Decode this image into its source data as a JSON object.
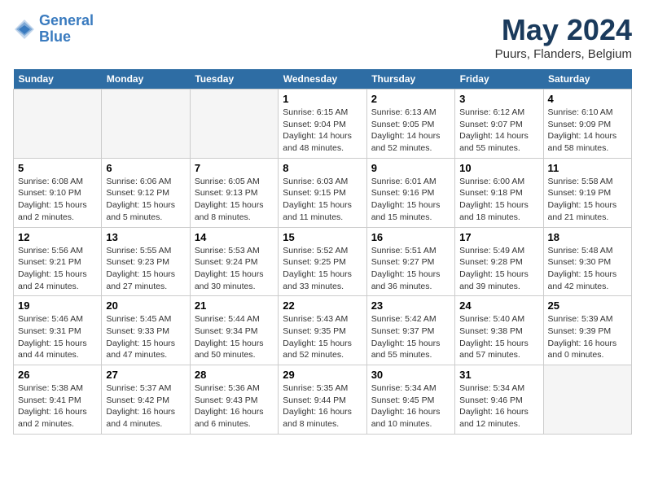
{
  "logo": {
    "line1": "General",
    "line2": "Blue"
  },
  "title": "May 2024",
  "location": "Puurs, Flanders, Belgium",
  "days_header": [
    "Sunday",
    "Monday",
    "Tuesday",
    "Wednesday",
    "Thursday",
    "Friday",
    "Saturday"
  ],
  "weeks": [
    [
      {
        "day": "",
        "info": ""
      },
      {
        "day": "",
        "info": ""
      },
      {
        "day": "",
        "info": ""
      },
      {
        "day": "1",
        "info": "Sunrise: 6:15 AM\nSunset: 9:04 PM\nDaylight: 14 hours\nand 48 minutes."
      },
      {
        "day": "2",
        "info": "Sunrise: 6:13 AM\nSunset: 9:05 PM\nDaylight: 14 hours\nand 52 minutes."
      },
      {
        "day": "3",
        "info": "Sunrise: 6:12 AM\nSunset: 9:07 PM\nDaylight: 14 hours\nand 55 minutes."
      },
      {
        "day": "4",
        "info": "Sunrise: 6:10 AM\nSunset: 9:09 PM\nDaylight: 14 hours\nand 58 minutes."
      }
    ],
    [
      {
        "day": "5",
        "info": "Sunrise: 6:08 AM\nSunset: 9:10 PM\nDaylight: 15 hours\nand 2 minutes."
      },
      {
        "day": "6",
        "info": "Sunrise: 6:06 AM\nSunset: 9:12 PM\nDaylight: 15 hours\nand 5 minutes."
      },
      {
        "day": "7",
        "info": "Sunrise: 6:05 AM\nSunset: 9:13 PM\nDaylight: 15 hours\nand 8 minutes."
      },
      {
        "day": "8",
        "info": "Sunrise: 6:03 AM\nSunset: 9:15 PM\nDaylight: 15 hours\nand 11 minutes."
      },
      {
        "day": "9",
        "info": "Sunrise: 6:01 AM\nSunset: 9:16 PM\nDaylight: 15 hours\nand 15 minutes."
      },
      {
        "day": "10",
        "info": "Sunrise: 6:00 AM\nSunset: 9:18 PM\nDaylight: 15 hours\nand 18 minutes."
      },
      {
        "day": "11",
        "info": "Sunrise: 5:58 AM\nSunset: 9:19 PM\nDaylight: 15 hours\nand 21 minutes."
      }
    ],
    [
      {
        "day": "12",
        "info": "Sunrise: 5:56 AM\nSunset: 9:21 PM\nDaylight: 15 hours\nand 24 minutes."
      },
      {
        "day": "13",
        "info": "Sunrise: 5:55 AM\nSunset: 9:23 PM\nDaylight: 15 hours\nand 27 minutes."
      },
      {
        "day": "14",
        "info": "Sunrise: 5:53 AM\nSunset: 9:24 PM\nDaylight: 15 hours\nand 30 minutes."
      },
      {
        "day": "15",
        "info": "Sunrise: 5:52 AM\nSunset: 9:25 PM\nDaylight: 15 hours\nand 33 minutes."
      },
      {
        "day": "16",
        "info": "Sunrise: 5:51 AM\nSunset: 9:27 PM\nDaylight: 15 hours\nand 36 minutes."
      },
      {
        "day": "17",
        "info": "Sunrise: 5:49 AM\nSunset: 9:28 PM\nDaylight: 15 hours\nand 39 minutes."
      },
      {
        "day": "18",
        "info": "Sunrise: 5:48 AM\nSunset: 9:30 PM\nDaylight: 15 hours\nand 42 minutes."
      }
    ],
    [
      {
        "day": "19",
        "info": "Sunrise: 5:46 AM\nSunset: 9:31 PM\nDaylight: 15 hours\nand 44 minutes."
      },
      {
        "day": "20",
        "info": "Sunrise: 5:45 AM\nSunset: 9:33 PM\nDaylight: 15 hours\nand 47 minutes."
      },
      {
        "day": "21",
        "info": "Sunrise: 5:44 AM\nSunset: 9:34 PM\nDaylight: 15 hours\nand 50 minutes."
      },
      {
        "day": "22",
        "info": "Sunrise: 5:43 AM\nSunset: 9:35 PM\nDaylight: 15 hours\nand 52 minutes."
      },
      {
        "day": "23",
        "info": "Sunrise: 5:42 AM\nSunset: 9:37 PM\nDaylight: 15 hours\nand 55 minutes."
      },
      {
        "day": "24",
        "info": "Sunrise: 5:40 AM\nSunset: 9:38 PM\nDaylight: 15 hours\nand 57 minutes."
      },
      {
        "day": "25",
        "info": "Sunrise: 5:39 AM\nSunset: 9:39 PM\nDaylight: 16 hours\nand 0 minutes."
      }
    ],
    [
      {
        "day": "26",
        "info": "Sunrise: 5:38 AM\nSunset: 9:41 PM\nDaylight: 16 hours\nand 2 minutes."
      },
      {
        "day": "27",
        "info": "Sunrise: 5:37 AM\nSunset: 9:42 PM\nDaylight: 16 hours\nand 4 minutes."
      },
      {
        "day": "28",
        "info": "Sunrise: 5:36 AM\nSunset: 9:43 PM\nDaylight: 16 hours\nand 6 minutes."
      },
      {
        "day": "29",
        "info": "Sunrise: 5:35 AM\nSunset: 9:44 PM\nDaylight: 16 hours\nand 8 minutes."
      },
      {
        "day": "30",
        "info": "Sunrise: 5:34 AM\nSunset: 9:45 PM\nDaylight: 16 hours\nand 10 minutes."
      },
      {
        "day": "31",
        "info": "Sunrise: 5:34 AM\nSunset: 9:46 PM\nDaylight: 16 hours\nand 12 minutes."
      },
      {
        "day": "",
        "info": ""
      }
    ]
  ]
}
